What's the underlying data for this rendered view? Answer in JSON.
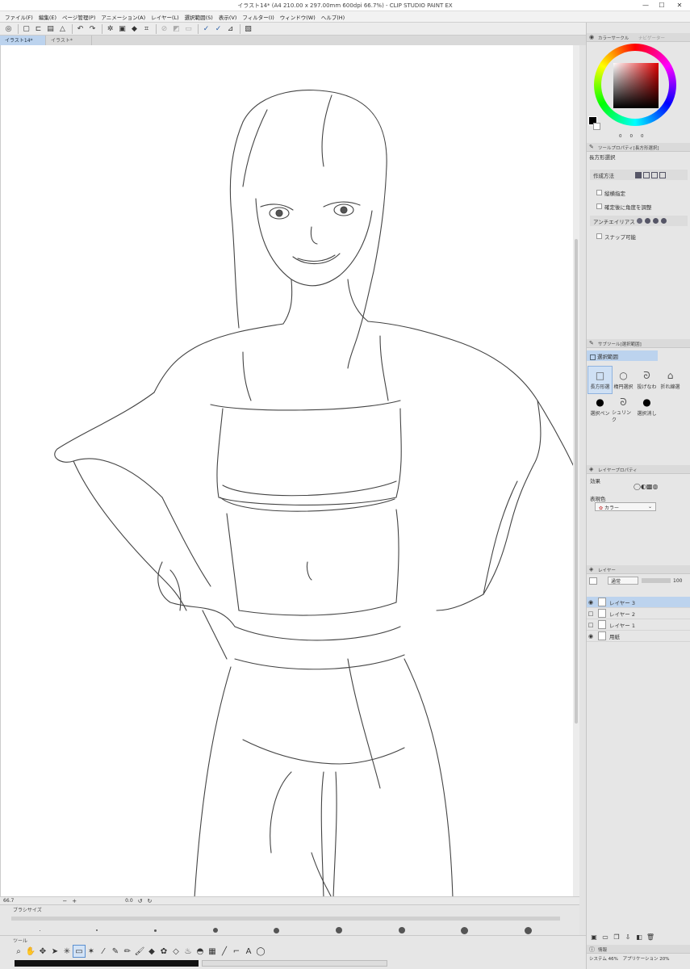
{
  "window": {
    "title": "イラスト14* (A4 210.00 x 297.00mm 600dpi 66.7%) - CLIP STUDIO PAINT EX",
    "min": "—",
    "max": "☐",
    "close": "✕"
  },
  "menu": [
    "ファイル(F)",
    "編集(E)",
    "ページ管理(P)",
    "アニメーション(A)",
    "レイヤー(L)",
    "選択範囲(S)",
    "表示(V)",
    "フィルター(I)",
    "ウィンドウ(W)",
    "ヘルプ(H)"
  ],
  "tabs": [
    "イラスト14*",
    "イラスト*"
  ],
  "status": {
    "zoom": "66.7",
    "angle": "0.0"
  },
  "brush_size": {
    "title": "ブラシサイズ"
  },
  "tool_panel": {
    "title": "ツール"
  },
  "color_panel": {
    "tab1": "カラーサークル",
    "tab2": "ナビゲーター",
    "values": [
      "0",
      "0",
      "0"
    ]
  },
  "tool_property": {
    "header": "ツールプロパティ[長方形選択]",
    "name": "長方形選択",
    "rows": [
      "作成方法",
      "縦横指定",
      "確定後に角度を調整",
      "アンチエイリアス",
      "スナップ可能"
    ]
  },
  "sub_tool": {
    "header": "サブツール[選択範囲]",
    "group": "選択範囲",
    "items": [
      "長方形選",
      "楕円選択",
      "投げなわ",
      "折れ線選",
      "選択ペン",
      "シュリンク",
      "選択消し"
    ]
  },
  "layer_property": {
    "header": "レイヤープロパティ",
    "effect_label": "効果",
    "display_color_label": "表現色",
    "display_color_value": "カラー"
  },
  "layers": {
    "header": "レイヤー",
    "blend": "通常",
    "opacity": "100",
    "items": [
      {
        "name": "レイヤー 3",
        "visible": true,
        "selected": true
      },
      {
        "name": "レイヤー 2",
        "visible": false,
        "selected": false
      },
      {
        "name": "レイヤー 1",
        "visible": false,
        "selected": false
      },
      {
        "name": "用紙",
        "visible": true,
        "selected": false
      }
    ]
  },
  "info": {
    "header": "情報",
    "system": "システム 46%",
    "app": "アプリケーション 20%"
  },
  "colors": {
    "accent": "#bcd3ee",
    "panel": "#e6e6e6"
  }
}
